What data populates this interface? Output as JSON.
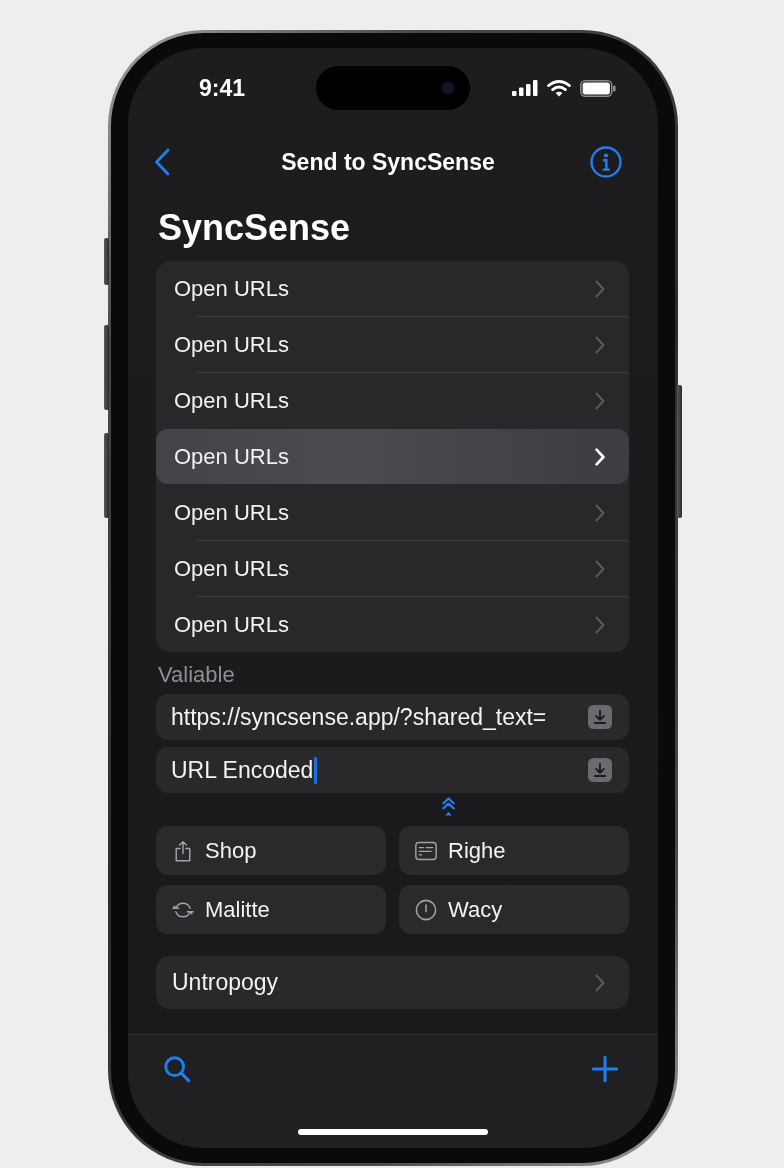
{
  "status_bar": {
    "time": "9:41"
  },
  "nav": {
    "title": "Send to SyncSense"
  },
  "header": {
    "title": "SyncSense"
  },
  "actions": [
    {
      "label": "Open URLs",
      "selected": false
    },
    {
      "label": "Open URLs",
      "selected": false
    },
    {
      "label": "Open URLs",
      "selected": false
    },
    {
      "label": "Open URLs",
      "selected": true
    },
    {
      "label": "Open URLs",
      "selected": false
    },
    {
      "label": "Open URLs",
      "selected": false
    },
    {
      "label": "Open URLs",
      "selected": false
    }
  ],
  "variable_section": {
    "label": "Valiable",
    "fields": [
      {
        "value": "https://syncsense.app/?shared_text=",
        "focused": false
      },
      {
        "value": "URL Encoded",
        "focused": true
      }
    ]
  },
  "quick_actions": [
    {
      "label": "Shop"
    },
    {
      "label": "Righe"
    },
    {
      "label": "Malitte"
    },
    {
      "label": "Wacy"
    }
  ],
  "menu_row": {
    "label": "Untropogy"
  }
}
